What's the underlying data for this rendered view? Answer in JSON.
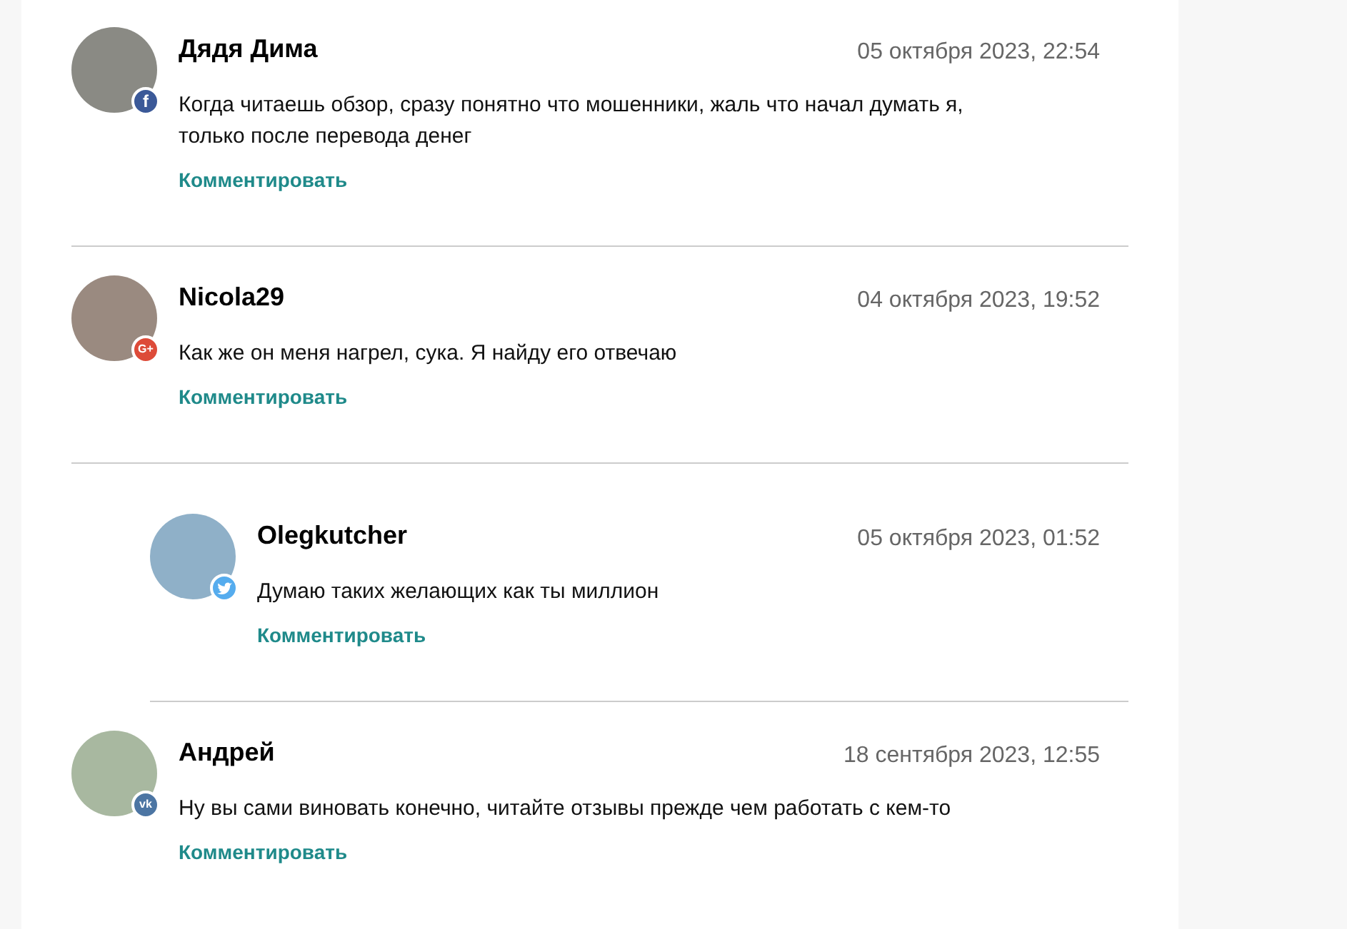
{
  "comments": [
    {
      "author": "Дядя Дима",
      "date": "05 октября 2023, 22:54",
      "text": "Когда читаешь обзор, сразу понятно что мошенники, жаль что начал думать я, только после перевода денег",
      "reply_link": "Комментировать",
      "network": {
        "kind": "facebook",
        "label": "f"
      },
      "reply": false
    },
    {
      "author": "Nicola29",
      "date": "04 октября 2023, 19:52",
      "text": "Как же он меня нагрел, сука. Я найду его отвечаю",
      "reply_link": "Комментировать",
      "network": {
        "kind": "google",
        "label": "G+"
      },
      "reply": false
    },
    {
      "author": "Olegkutcher",
      "date": "05 октября 2023, 01:52",
      "text": "Думаю таких желающих как ты миллион",
      "reply_link": "Комментировать",
      "network": {
        "kind": "twitter"
      },
      "reply": true
    },
    {
      "author": "Андрей",
      "date": "18 сентября 2023, 12:55",
      "text": "Ну вы сами виновать конечно, читайте отзывы прежде чем работать с кем-то",
      "reply_link": "Комментировать",
      "network": {
        "kind": "vk",
        "label": "vk"
      },
      "reply": false
    }
  ]
}
